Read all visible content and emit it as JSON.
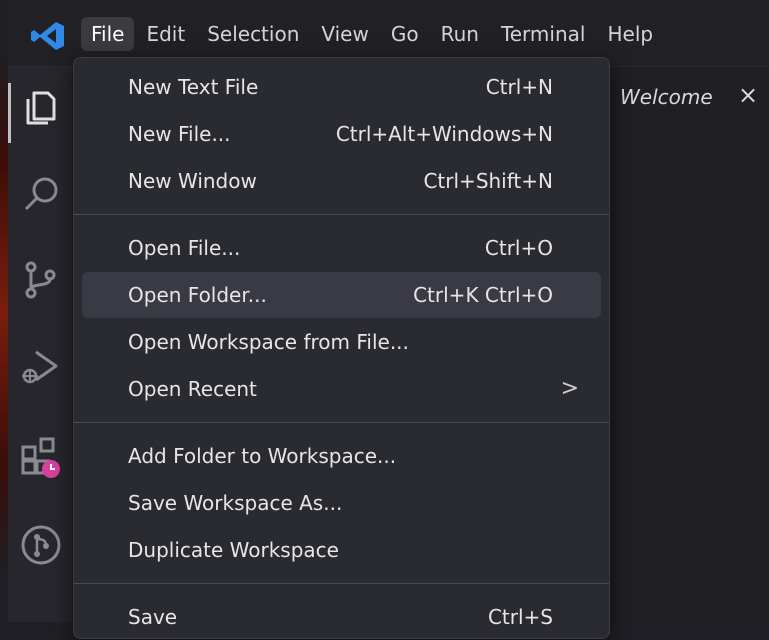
{
  "menubar": {
    "items": [
      "File",
      "Edit",
      "Selection",
      "View",
      "Go",
      "Run",
      "Terminal",
      "Help"
    ],
    "active": "File"
  },
  "tab": {
    "label": "Welcome",
    "close": "×"
  },
  "file_menu": {
    "groups": [
      [
        {
          "label": "New Text File",
          "shortcut": "Ctrl+N"
        },
        {
          "label": "New File...",
          "shortcut": "Ctrl+Alt+Windows+N"
        },
        {
          "label": "New Window",
          "shortcut": "Ctrl+Shift+N"
        }
      ],
      [
        {
          "label": "Open File...",
          "shortcut": "Ctrl+O"
        },
        {
          "label": "Open Folder...",
          "shortcut": "Ctrl+K Ctrl+O",
          "highlighted": true
        },
        {
          "label": "Open Workspace from File...",
          "shortcut": ""
        },
        {
          "label": "Open Recent",
          "shortcut": "",
          "submenu": true
        }
      ],
      [
        {
          "label": "Add Folder to Workspace...",
          "shortcut": ""
        },
        {
          "label": "Save Workspace As...",
          "shortcut": ""
        },
        {
          "label": "Duplicate Workspace",
          "shortcut": ""
        }
      ],
      [
        {
          "label": "Save",
          "shortcut": "Ctrl+S"
        }
      ]
    ],
    "submenu_chevron": ">"
  },
  "activitybar": {
    "icons": [
      "explorer-icon",
      "search-icon",
      "source-control-icon",
      "run-debug-icon",
      "extensions-icon",
      "git-graph-icon"
    ]
  },
  "colors": {
    "accent_logo": "#2e8ae6",
    "menu_bg": "#2a2a31",
    "hover_bg": "#3a3a44",
    "badge": "#d6409f"
  }
}
